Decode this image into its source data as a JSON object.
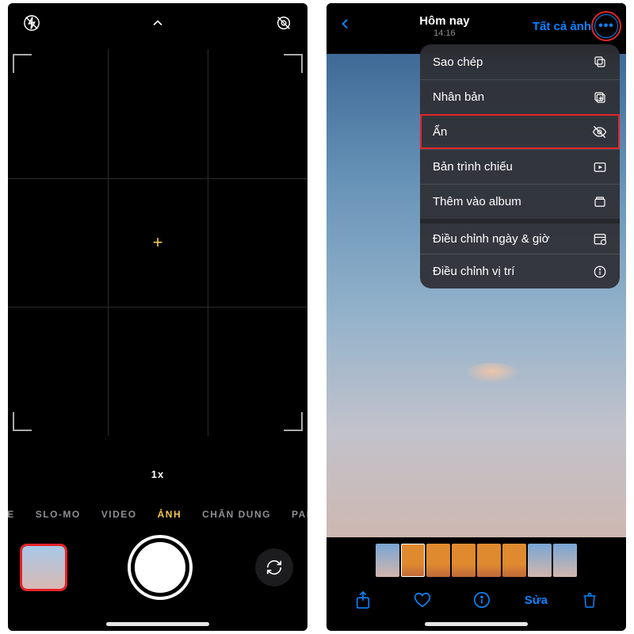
{
  "left": {
    "zoom": "1x",
    "modes": {
      "lapse": "PSE",
      "slomo": "SLO-MO",
      "video": "VIDEO",
      "photo": "ẢNH",
      "portrait": "CHÂN DUNG",
      "pano": "PANO"
    }
  },
  "right": {
    "header": {
      "title": "Hôm nay",
      "time": "14:16",
      "all_photos": "Tất cả ảnh",
      "more": "•••"
    },
    "menu": {
      "copy": "Sao chép",
      "duplicate": "Nhân bản",
      "hide": "Ẩn",
      "slideshow": "Bản trình chiếu",
      "add_album": "Thêm vào album",
      "adjust_date": "Điều chỉnh ngày & giờ",
      "adjust_loc": "Điều chỉnh vị trí"
    },
    "toolbar": {
      "edit": "Sửa"
    }
  }
}
